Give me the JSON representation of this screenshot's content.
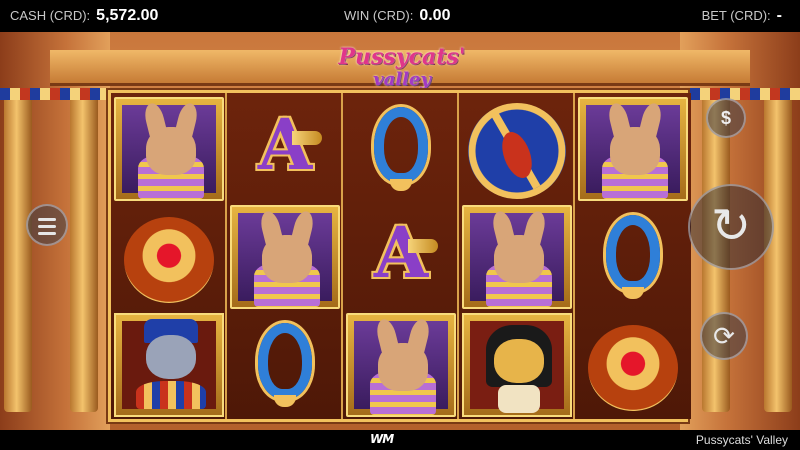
{
  "topbar": {
    "cash_label": "CASH (CRD):",
    "cash_value": "5,572.00",
    "win_label": "WIN (CRD):",
    "win_value": "0.00",
    "bet_label": "BET (CRD):",
    "bet_value": "-"
  },
  "logo": {
    "line1": "Pussycats'",
    "line2": "valley"
  },
  "reels": [
    [
      "cat-princess",
      "scarab-amulet",
      "pharaoh-cat"
    ],
    [
      "A",
      "cat-princess",
      "Q"
    ],
    [
      "Q",
      "A",
      "cat-princess"
    ],
    [
      "staff-and-feather",
      "cat-princess",
      "anubis-cat"
    ],
    [
      "cat-princess",
      "Q",
      "scarab-amulet"
    ]
  ],
  "controls": {
    "menu_icon": "menu-icon",
    "coins_icon": "coins-icon",
    "coins_glyph": "$",
    "spin_icon": "spin-icon",
    "spin_glyph": "↻",
    "autoplay_icon": "autoplay-icon",
    "autoplay_glyph": "⟳"
  },
  "footer": {
    "provider": "WM",
    "game_title": "Pussycats' Valley"
  },
  "colors": {
    "frame_gold": "#f2c15d",
    "reel_bg": "#5a1e0c",
    "letter_purple": "#8a3fc7",
    "q_blue": "#2f7fd8"
  }
}
